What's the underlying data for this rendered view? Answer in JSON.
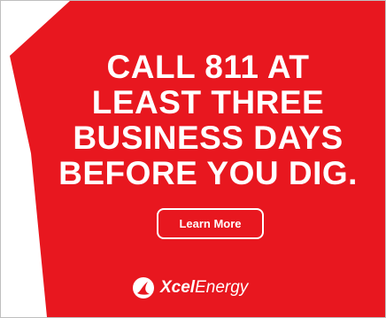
{
  "ad": {
    "headline_lines": [
      "CALL 811 AT",
      "LEAST THREE",
      "BUSINESS DAYS",
      "BEFORE YOU DIG."
    ],
    "cta_label": "Learn More",
    "brand": {
      "name_bold": "Xcel",
      "name_light": "Energy",
      "logo_icon": "xcel-swoosh-icon"
    },
    "colors": {
      "background": "#ffffff",
      "accent_red": "#e8171f",
      "text": "#ffffff"
    }
  }
}
